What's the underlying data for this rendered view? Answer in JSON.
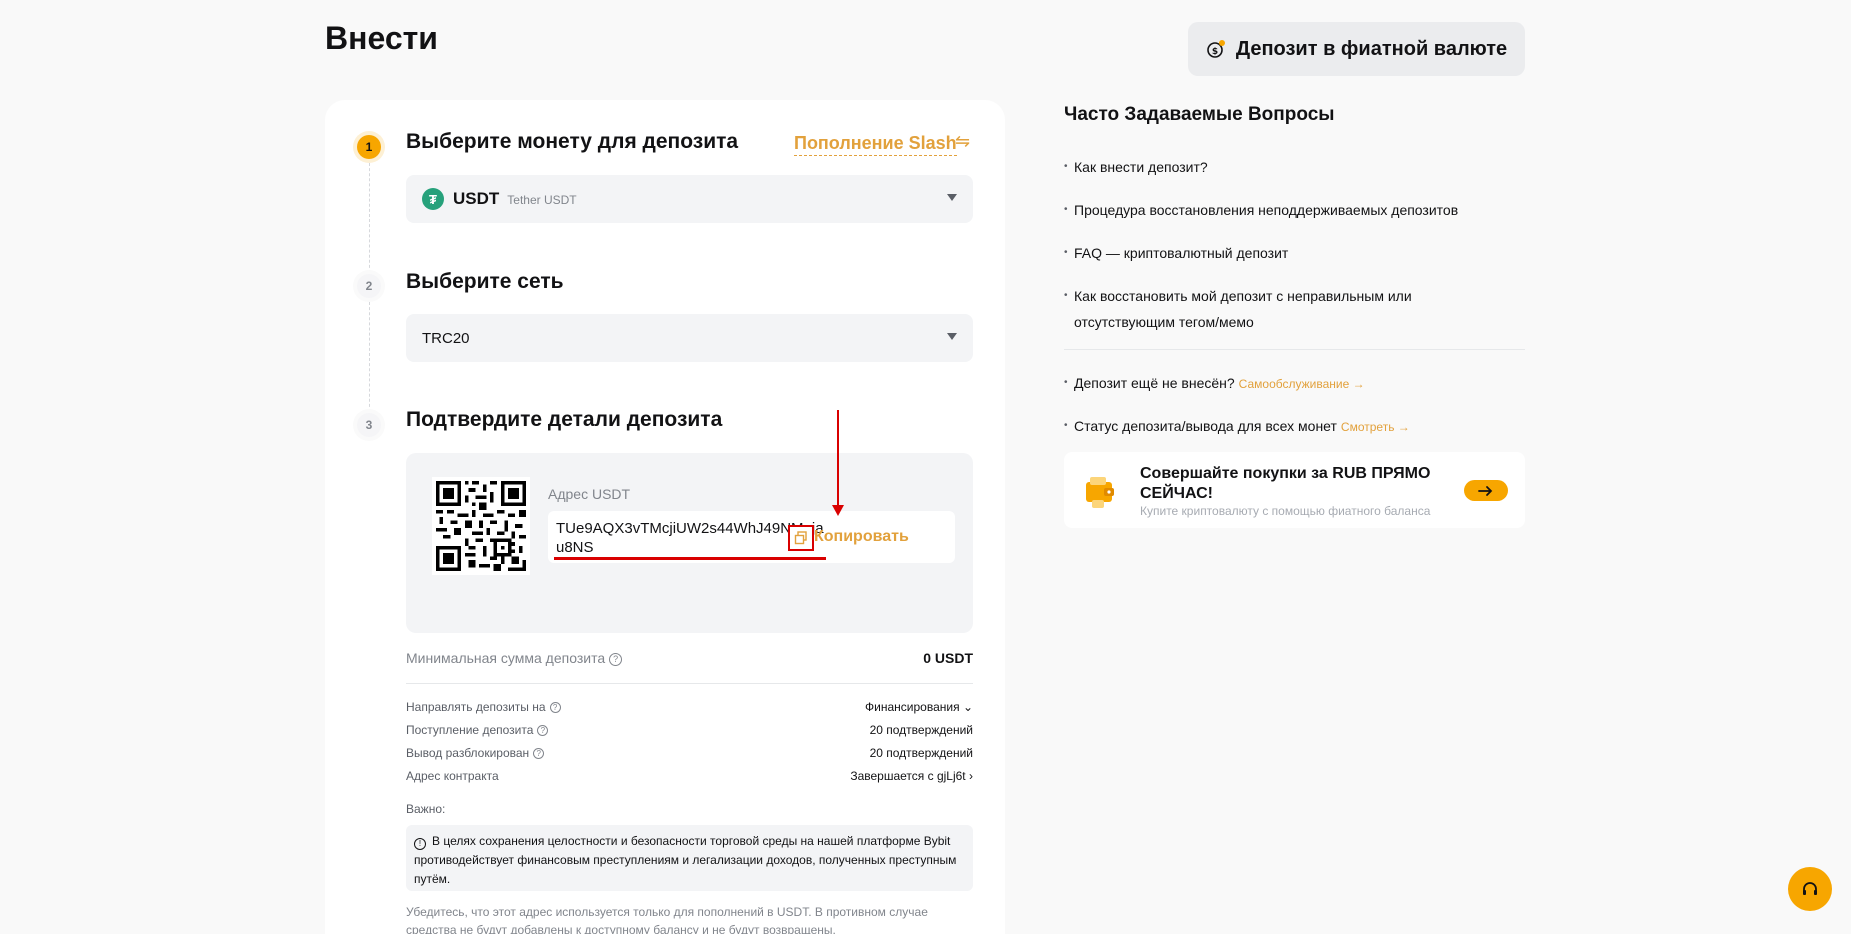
{
  "header": {
    "title": "Внести",
    "fiat_button": "Депозит в фиатной валюте"
  },
  "steps": [
    {
      "number": "1",
      "title": "Выберите монету для депозита"
    },
    {
      "number": "2",
      "title": "Выберите сеть"
    },
    {
      "number": "3",
      "title": "Подтвердите детали депозита"
    }
  ],
  "slash_link": "Пополнение Slash",
  "coin_select": {
    "symbol": "USDT",
    "name": "Tether USDT",
    "icon": "tether-icon"
  },
  "network_select": {
    "value": "TRC20"
  },
  "deposit": {
    "address_label": "Адрес USDT",
    "address": "TUe9AQX3vTMcjiUW2s44WhJ49NMajau8NS",
    "copy_label": "Копировать"
  },
  "min_deposit": {
    "label": "Минимальная сумма депозита",
    "value": "0 USDT"
  },
  "info_rows": [
    {
      "label": "Направлять депозиты на",
      "value": "Финансирования",
      "help": true,
      "suffix": "⌄"
    },
    {
      "label": "Поступление депозита",
      "value": "20 подтверждений",
      "help": true,
      "suffix": ""
    },
    {
      "label": "Вывод разблокирован",
      "value": "20 подтверждений",
      "help": true,
      "suffix": ""
    },
    {
      "label": "Адрес контракта",
      "value": "Завершается с gjLj6t",
      "help": false,
      "suffix": "›"
    }
  ],
  "important": {
    "label": "Важно:",
    "notice": "В целях сохранения целостности и безопасности торговой среды на нашей платформе Bybit противодействует финансовым преступлениям и легализации доходов, полученных преступным путём.",
    "bottom_note": "Убедитесь, что этот адрес используется только для пополнений в USDT. В противном случае средства не будут добавлены к доступному балансу и не будут возвращены."
  },
  "faq": {
    "title": "Часто Задаваемые Вопросы",
    "items": [
      "Как внести депозит?",
      "Процедура восстановления неподдерживаемых депозитов",
      "FAQ — криптовалютный депозит",
      "Как восстановить мой депозит с неправильным или отсутствующим тегом/мемо"
    ],
    "extra": [
      {
        "text": "Депозит ещё не внесён?",
        "link": "Самообслуживание"
      },
      {
        "text": "Статус депозита/вывода для всех монет",
        "link": "Смотреть"
      }
    ]
  },
  "promo": {
    "title": "Совершайте покупки за RUB ПРЯМО СЕЙЧАС!",
    "subtitle": "Купите криптовалюту с помощью фиатного баланса"
  },
  "colors": {
    "accent": "#f7a600",
    "link": "#e2a13c",
    "annotation": "#d90000"
  }
}
